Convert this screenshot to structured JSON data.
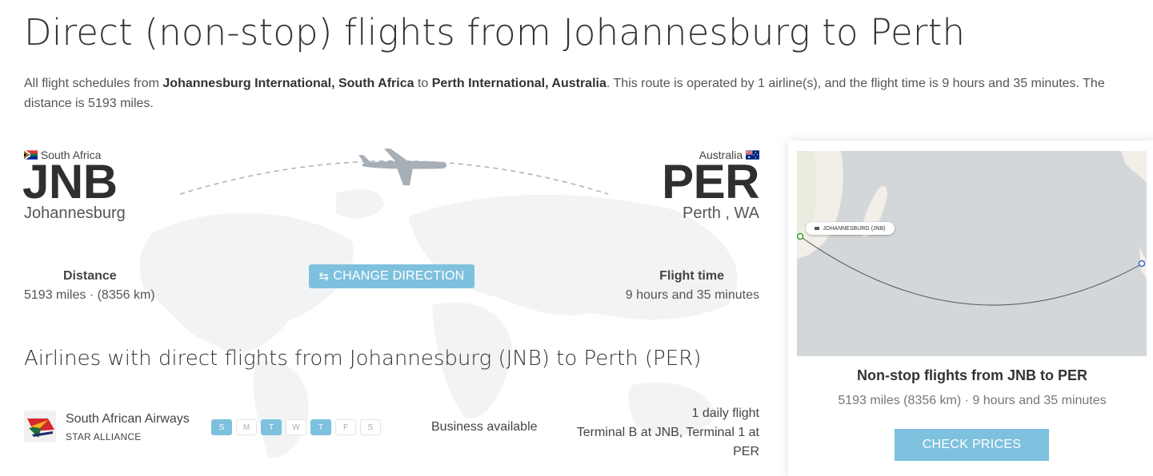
{
  "page": {
    "title": "Direct (non-stop) flights from Johannesburg to Perth",
    "intro": {
      "p1": "All flight schedules from ",
      "origin_airport": "Johannesburg International, South Africa",
      "p2": " to ",
      "dest_airport": "Perth International, Australia",
      "p3": ". This route is operated by 1 airline(s), and the flight time is 9 hours and 35 minutes. The distance is 5193 miles."
    }
  },
  "route": {
    "origin": {
      "country": "South Africa",
      "code": "JNB",
      "city": "Johannesburg",
      "flag_icon": "south-africa-flag-icon"
    },
    "destination": {
      "country": "Australia",
      "code": "PER",
      "city": "Perth , WA",
      "flag_icon": "australia-flag-icon"
    },
    "distance_label": "Distance",
    "distance_value": "5193 miles · (8356 km)",
    "flight_time_label": "Flight time",
    "flight_time_value": "9 hours and 35 minutes",
    "change_direction_label": "CHANGE DIRECTION",
    "change_direction_icon": "⇆"
  },
  "airlines": {
    "heading": "Airlines with direct flights from Johannesburg (JNB) to Perth (PER)",
    "rows": [
      {
        "name": "South African Airways",
        "alliance": "STAR ALLIANCE",
        "days": [
          {
            "letter": "S",
            "active": true
          },
          {
            "letter": "M",
            "active": false
          },
          {
            "letter": "T",
            "active": true
          },
          {
            "letter": "W",
            "active": false
          },
          {
            "letter": "T",
            "active": true
          },
          {
            "letter": "F",
            "active": false
          },
          {
            "letter": "S",
            "active": false
          }
        ],
        "cabin": "Business available",
        "frequency": "1 daily flight",
        "terminals": "Terminal B at JNB, Terminal 1 at PER"
      }
    ]
  },
  "side_card": {
    "map_label": "JOHANNESBURG (JNB)",
    "title": "Non-stop flights from JNB to PER",
    "subtitle": "5193 miles (8356 km) · 9 hours and 35 minutes",
    "button_label": "CHECK PRICES"
  },
  "colors": {
    "accent": "#7ec1de",
    "map_water": "#d4d7d9",
    "map_land": "#f2efe9",
    "text_dark": "#333333"
  }
}
